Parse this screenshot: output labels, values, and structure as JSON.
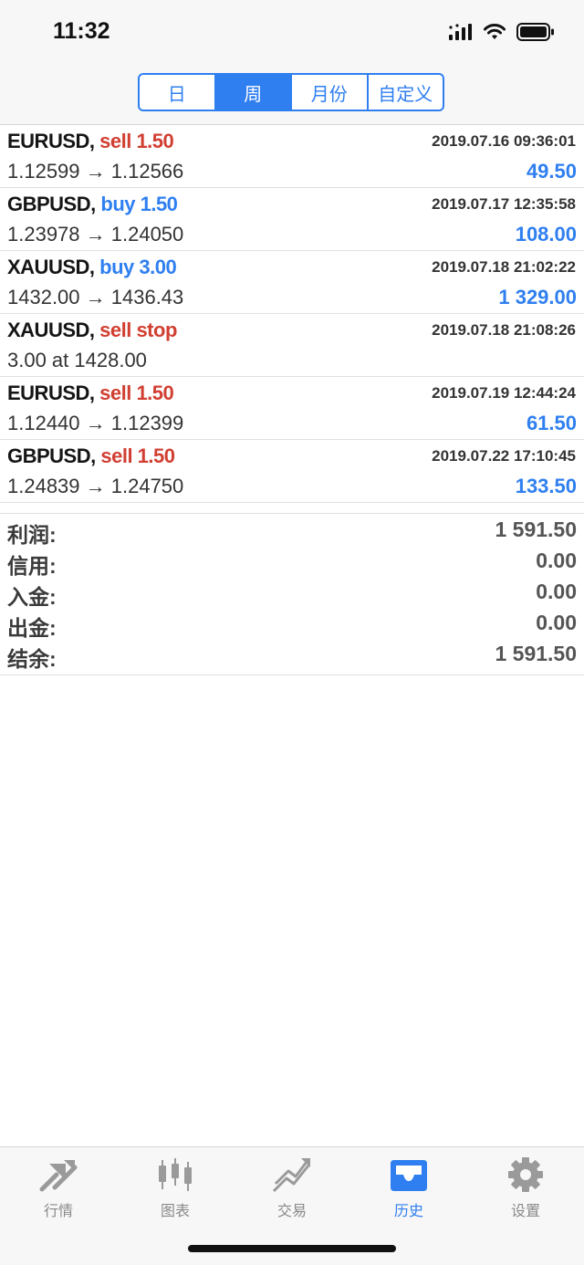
{
  "status": {
    "time": "11:32",
    "icons": [
      "signal-icon",
      "wifi-icon",
      "battery-icon"
    ]
  },
  "segments": [
    {
      "label": "日",
      "active": false
    },
    {
      "label": "周",
      "active": true
    },
    {
      "label": "月份",
      "active": false
    },
    {
      "label": "自定义",
      "active": false
    }
  ],
  "deals": [
    {
      "symbol": "EURUSD,",
      "side": "sell 1.50",
      "side_type": "sell",
      "date": "2019.07.16 09:36:01",
      "prices": "1.12599 → 1.12566",
      "profit": "49.50"
    },
    {
      "symbol": "GBPUSD,",
      "side": "buy 1.50",
      "side_type": "buy",
      "date": "2019.07.17 12:35:58",
      "prices": "1.23978 → 1.24050",
      "profit": "108.00"
    },
    {
      "symbol": "XAUUSD,",
      "side": "buy 3.00",
      "side_type": "buy",
      "date": "2019.07.18 21:02:22",
      "prices": "1432.00 → 1436.43",
      "profit": "1 329.00"
    },
    {
      "symbol": "XAUUSD,",
      "side": "sell stop",
      "side_type": "sell",
      "date": "2019.07.18 21:08:26",
      "prices": "3.00 at 1428.00",
      "profit": ""
    },
    {
      "symbol": "EURUSD,",
      "side": "sell 1.50",
      "side_type": "sell",
      "date": "2019.07.19 12:44:24",
      "prices": "1.12440 → 1.12399",
      "profit": "61.50"
    },
    {
      "symbol": "GBPUSD,",
      "side": "sell 1.50",
      "side_type": "sell",
      "date": "2019.07.22 17:10:45",
      "prices": "1.24839 → 1.24750",
      "profit": "133.50"
    }
  ],
  "summary": [
    {
      "label": "利润:",
      "value": "1 591.50"
    },
    {
      "label": "信用:",
      "value": "0.00"
    },
    {
      "label": "入金:",
      "value": "0.00"
    },
    {
      "label": "出金:",
      "value": "0.00"
    },
    {
      "label": "结余:",
      "value": "1 591.50"
    }
  ],
  "tabs": [
    {
      "label": "行情",
      "icon": "quotes-icon",
      "active": false
    },
    {
      "label": "图表",
      "icon": "chart-icon",
      "active": false
    },
    {
      "label": "交易",
      "icon": "trade-icon",
      "active": false
    },
    {
      "label": "历史",
      "icon": "history-icon",
      "active": true
    },
    {
      "label": "设置",
      "icon": "settings-icon",
      "active": false
    }
  ],
  "colors": {
    "accent": "#2f7ff0",
    "sell": "#d13f32",
    "buy": "#2f7ff0",
    "inactive_tab": "#9a9a9a"
  }
}
